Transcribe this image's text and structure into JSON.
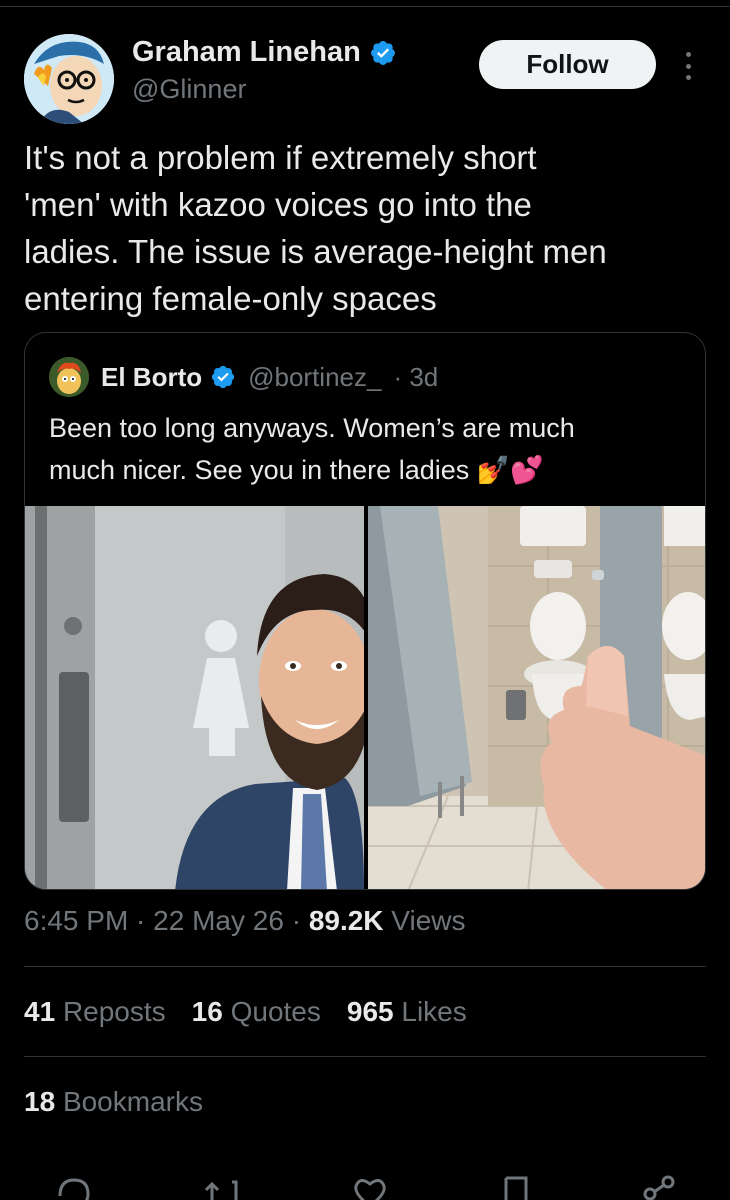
{
  "author": {
    "name": "Graham Linehan",
    "handle": "@Glinner",
    "verified": true
  },
  "header": {
    "follow_label": "Follow",
    "more_icon": "more-vertical-icon"
  },
  "tweet": {
    "text": "It's not a problem if extremely short\n'men' with kazoo voices  go into the\nladies. The issue is average-height men\nentering female-only spaces"
  },
  "quoted": {
    "name": "El Borto",
    "handle": "@bortinez_",
    "time": "· 3d",
    "text": "Been too long anyways. Women’s are much\nmuch nicer. See you in there ladies 💅💕"
  },
  "meta": {
    "time": "6:45 PM",
    "sep1": " · ",
    "date": "22 May 26",
    "sep2": " · ",
    "views_count": "89.2K",
    "views_label": " Views"
  },
  "stats": {
    "reposts_count": "41",
    "reposts_label": "Reposts",
    "quotes_count": "16",
    "quotes_label": "Quotes",
    "likes_count": "965",
    "likes_label": "Likes",
    "bookmarks_count": "18",
    "bookmarks_label": "Bookmarks"
  },
  "actions": [
    "reply-icon",
    "repost-icon",
    "like-icon",
    "bookmark-icon",
    "share-icon"
  ],
  "colors": {
    "background": "#000000",
    "text": "#e7e9ea",
    "muted": "#71767b",
    "divider": "#2f3336",
    "verified": "#1d9bf0"
  }
}
